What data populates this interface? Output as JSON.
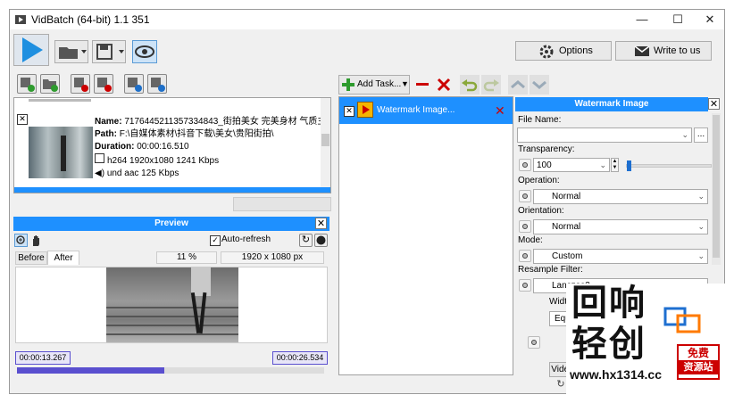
{
  "window": {
    "title": "VidBatch (64-bit) 1.1 351",
    "minimize": "—",
    "maximize": "☐",
    "close": "✕"
  },
  "toolbar": {
    "options_label": "Options",
    "write_label": "Write to us"
  },
  "file_item": {
    "name_label": "Name:",
    "name_value": "7176445211357334843_街拍美女 完美身材 气质主",
    "path_label": "Path:",
    "path_value": "F:\\自媒体素材\\抖音下载\\美女\\贵阳街拍\\",
    "duration_label": "Duration:",
    "duration_value": "00:00:16.510",
    "video_info": "h264 1920x1080 1241 Kbps",
    "audio_info": "und aac 125 Kbps"
  },
  "preview": {
    "header": "Preview",
    "auto_refresh": "Auto-refresh",
    "tab_before": "Before",
    "tab_after": "After",
    "zoom": "11 %",
    "resolution": "1920 x 1080 px",
    "time_start": "00:00:13.267",
    "time_end": "00:00:26.534",
    "progress": 0.48
  },
  "tasks": {
    "add_task": "Add Task...",
    "items": [
      {
        "label": "Watermark Image..."
      }
    ]
  },
  "watermark": {
    "header": "Watermark Image",
    "file_name_label": "File Name:",
    "file_name_value": "",
    "browse": "...",
    "transparency_label": "Transparency:",
    "transparency_value": "100",
    "operation_label": "Operation:",
    "operation_value": "Normal",
    "orientation_label": "Orientation:",
    "orientation_value": "Normal",
    "mode_label": "Mode:",
    "mode_value": "Custom",
    "resample_label": "Resample Filter:",
    "resample_value": "Lanczos3",
    "width_label": "Width:",
    "width_value": "Equal",
    "video_label": "Video"
  },
  "watermark_overlay": {
    "line1": "回响",
    "line2": "轻创",
    "url": "www.hx1314.cc",
    "badge1": "免费",
    "badge2": "资源站"
  },
  "colors": {
    "accent": "#1e90ff",
    "play": "#1e8fe0",
    "progress": "#5a4fcf",
    "remove": "#cc0000",
    "add": "#2e9b2e"
  }
}
